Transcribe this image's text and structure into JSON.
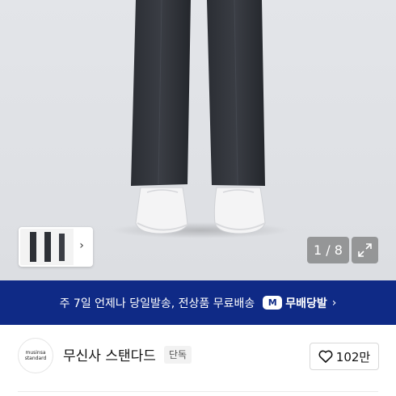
{
  "gallery": {
    "counter": "1 / 8",
    "thumbnail_chevron": "›",
    "expand_icon": "expand-icon"
  },
  "banner": {
    "text": "주 7일 언제나 당일발송, 전상품 무료배송",
    "logo_badge": "M",
    "logo_text": "무배당발",
    "chevron": "›",
    "bg_color": "#0f2a86"
  },
  "brand": {
    "logo_line1": "musinsa",
    "logo_line2": "standard",
    "name": "무신사 스탠다드",
    "badge": "단독",
    "like_count": "102만"
  }
}
